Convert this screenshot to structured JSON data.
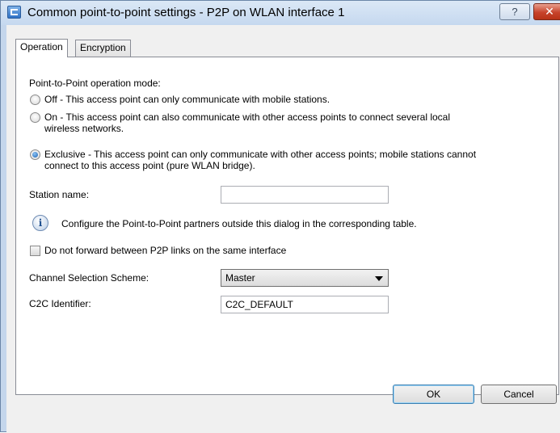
{
  "window": {
    "title": "Common point-to-point settings - P2P on WLAN interface 1",
    "help_label": "?",
    "close_label": "✕"
  },
  "tabs": [
    {
      "label": "Operation",
      "active": true
    },
    {
      "label": "Encryption",
      "active": false
    }
  ],
  "operation": {
    "mode_heading": "Point-to-Point operation mode:",
    "modes": [
      {
        "label": "Off - This access point can only communicate with mobile stations.",
        "checked": false
      },
      {
        "label": "On - This access point can also communicate with other access points to connect several local",
        "label_line2": "wireless networks.",
        "checked": false
      },
      {
        "label": "Exclusive - This access point can only communicate with other access points; mobile stations cannot",
        "label_line2": "connect to this access point (pure WLAN bridge).",
        "checked": true
      }
    ],
    "station_name_label": "Station name:",
    "station_name_value": "",
    "info_text": "Configure the Point-to-Point partners outside this dialog in the corresponding table.",
    "no_forward_label": "Do not forward between P2P links on the same interface",
    "no_forward_checked": false,
    "channel_scheme_label": "Channel Selection Scheme:",
    "channel_scheme_value": "Master",
    "c2c_label": "C2C Identifier:",
    "c2c_value": "C2C_DEFAULT"
  },
  "buttons": {
    "ok": "OK",
    "cancel": "Cancel"
  },
  "icons": {
    "app": "window-app-icon",
    "help": "help-icon",
    "close": "close-icon",
    "info": "info-icon",
    "dropdown": "chevron-down-icon"
  }
}
